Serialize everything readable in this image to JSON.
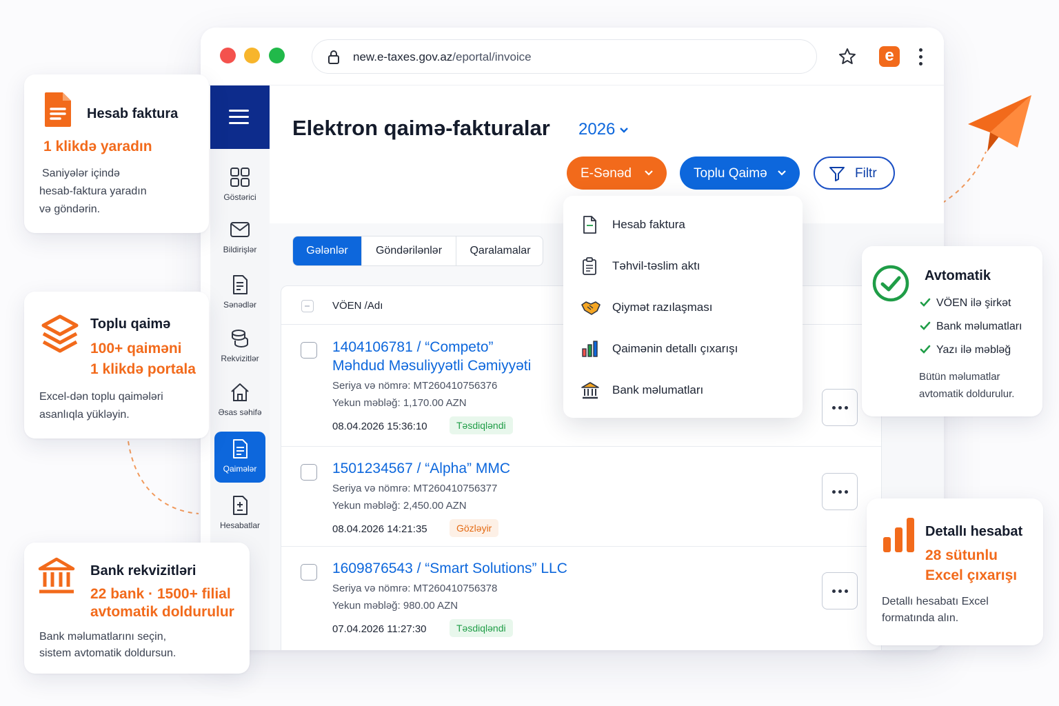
{
  "browser": {
    "url_domain": "new.e-taxes.gov.az",
    "url_path": "/eportal/invoice",
    "extension_letter": "e",
    "accent": "#f26a1b"
  },
  "sidebar": {
    "items": [
      {
        "label": "Göstərici",
        "icon": "grid-icon"
      },
      {
        "label": "Bildirişlər",
        "icon": "mail-icon"
      },
      {
        "label": "Sənədlər",
        "icon": "document-icon"
      },
      {
        "label": "Rekvizitlər",
        "icon": "coins-icon"
      },
      {
        "label": "Əsas səhifə",
        "icon": "home-icon"
      },
      {
        "label": "Qaimələr",
        "icon": "invoice-icon",
        "active": true
      },
      {
        "label": "Hesabatlar",
        "icon": "report-icon"
      }
    ]
  },
  "header": {
    "title": "Elektron qaimə-fakturalar",
    "year": "2026",
    "btn_esened": "E-Sənəd",
    "btn_toplu": "Toplu Qaimə",
    "btn_filtr": "Filtr"
  },
  "tabs": [
    "Gələnlər",
    "Göndərilənlər",
    "Qaralamalar"
  ],
  "table": {
    "header": "VÖEN /Adı",
    "rows": [
      {
        "title_line1": "1404106781 / “Competo”",
        "title_line2": "Məhdud Məsuliyyətli Cəmiyyəti",
        "serial": "Seriya və nömrə: MT260410756376",
        "amount": "Yekun məbləğ: 1,170.00 AZN",
        "date": "08.04.2026 15:36:10",
        "status": "Təsdiqləndi"
      },
      {
        "title_line1": "1501234567 / “Alpha” MMC",
        "serial": "Seriya və nömrə: MT260410756377",
        "amount": "Yekun məbləğ: 2,450.00 AZN",
        "date": "08.04.2026 14:21:35",
        "status": "Gözləyir"
      },
      {
        "title_line1": "1609876543 / “Smart Solutions” LLC",
        "serial": "Seriya və nömrə: MT260410756378",
        "amount": "Yekun məbləğ: 980.00 AZN",
        "date": "07.04.2026 11:27:30",
        "status": "Təsdiqləndi"
      }
    ]
  },
  "dropdown": {
    "items": [
      {
        "label": "Hesab faktura",
        "icon": "file-icon"
      },
      {
        "label": "Təhvil-təslim aktı",
        "icon": "clipboard-icon"
      },
      {
        "label": "Qiymət razılaşması",
        "icon": "handshake-icon"
      },
      {
        "label": "Qaimənin detallı çıxarışı",
        "icon": "bar-chart-icon"
      },
      {
        "label": "Bank məlumatları",
        "icon": "bank-icon"
      }
    ]
  },
  "cards": {
    "hesab": {
      "title": "Hesab faktura",
      "highlight": "1 klikdə yaradın",
      "text1": "Saniyələr içində",
      "text2": "hesab-faktura yaradın",
      "text3": "və göndərin."
    },
    "toplu": {
      "title": "Toplu qaimə",
      "highlight1": "100+ qaiməni",
      "highlight2": "1 klikdə portala",
      "text1": "Excel-dən toplu qaimələri",
      "text2": "asanlıqla yükləyin."
    },
    "bank": {
      "title": "Bank rekvizitləri",
      "highlight1": "22 bank · 1500+ filial",
      "highlight2": "avtomatik doldurulur",
      "text1": "Bank məlumatlarını seçin,",
      "text2": "sistem avtomatik doldursun."
    },
    "avto": {
      "title": "Avtomatik",
      "checks": [
        "VÖEN ilə şirkət",
        "Bank məlumatları",
        "Yazı ilə məbləğ"
      ],
      "text1": "Bütün məlumatlar",
      "text2": "avtomatik doldurulur."
    },
    "detal": {
      "title": "Detallı hesabat",
      "highlight1": "28 sütunlu",
      "highlight2": "Excel çıxarışı",
      "text1": "Detallı hesabatı Excel",
      "text2": "formatında alın."
    }
  },
  "colors": {
    "primary_blue": "#0d67dc",
    "navy": "#0d2c8c",
    "orange": "#f26a1b",
    "green": "#1f9d47"
  }
}
